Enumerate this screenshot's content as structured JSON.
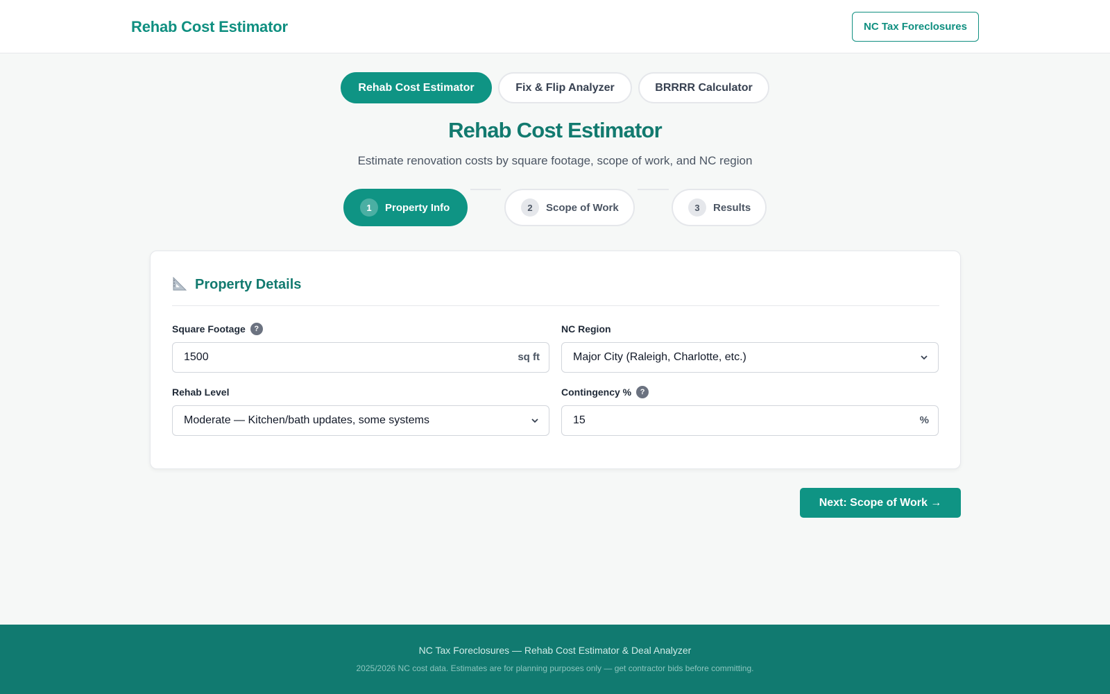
{
  "header": {
    "brand": "Rehab Cost Estimator",
    "link_button": "NC Tax Foreclosures"
  },
  "tool_tabs": [
    {
      "label": "Rehab Cost Estimator",
      "active": true
    },
    {
      "label": "Fix & Flip Analyzer",
      "active": false
    },
    {
      "label": "BRRRR Calculator",
      "active": false
    }
  ],
  "page": {
    "title": "Rehab Cost Estimator",
    "subtitle": "Estimate renovation costs by square footage, scope of work, and NC region"
  },
  "steps": [
    {
      "number": "1",
      "label": "Property Info",
      "active": true
    },
    {
      "number": "2",
      "label": "Scope of Work",
      "active": false
    },
    {
      "number": "3",
      "label": "Results",
      "active": false
    }
  ],
  "card": {
    "icon": "triangle-ruler-icon",
    "title": "Property Details",
    "fields": {
      "square_footage": {
        "label": "Square Footage",
        "help": "?",
        "value": "1500",
        "unit": "sq ft"
      },
      "region": {
        "label": "NC Region",
        "value": "Major City (Raleigh, Charlotte, etc.)"
      },
      "rehab_level": {
        "label": "Rehab Level",
        "value": "Moderate — Kitchen/bath updates, some systems"
      },
      "contingency": {
        "label": "Contingency %",
        "help": "?",
        "value": "15",
        "unit": "%"
      }
    }
  },
  "next_button": "Next: Scope of Work →",
  "footer": {
    "line1": "NC Tax Foreclosures — Rehab Cost Estimator & Deal Analyzer",
    "line2": "2025/2026 NC cost data. Estimates are for planning purposes only — get contractor bids before committing."
  },
  "colors": {
    "accent": "#0f9484",
    "title": "#127a6f",
    "footer_bg": "#117a70"
  }
}
